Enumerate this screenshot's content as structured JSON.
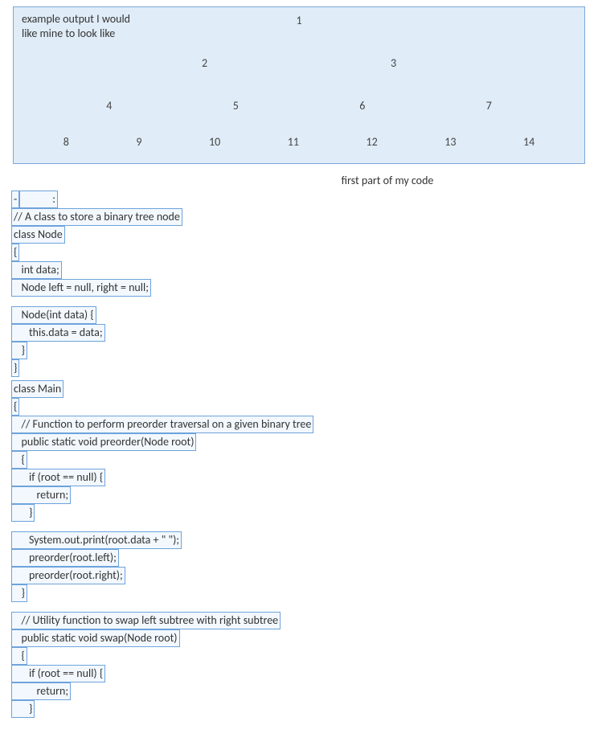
{
  "tree": {
    "caption": "example output I would like mine to look like",
    "rows": [
      [
        "1"
      ],
      [
        "2",
        "3"
      ],
      [
        "4",
        "5",
        "6",
        "7"
      ],
      [
        "8",
        "9",
        "10",
        "11",
        "12",
        "13",
        "14"
      ]
    ]
  },
  "section_label": "first part of my code",
  "code": {
    "l01a": "-",
    "l01b": "            :",
    "l02": "// A class to store a binary tree node",
    "l03": "class Node",
    "l04": "{",
    "l05a": "   int data;",
    "l06a": "   Node left = null, right = null;",
    "l07a": "   Node(int data) {",
    "l08a": "      this.data = data;",
    "l09a": "   }",
    "l10": "}",
    "l11": "class Main",
    "l12": "{",
    "l13a": "   // Function to perform preorder traversal on a given binary tree",
    "l14a": "   public static void preorder(Node root)",
    "l15a": "   {",
    "l16a": "      if (root == null) {",
    "l17a": "         return;",
    "l18a": "      }",
    "l19a": "      System.out.print(root.data + \" \");",
    "l20a": "      preorder(root.left);",
    "l21a": "      preorder(root.right);",
    "l22a": "   }",
    "l23a": "   // Utility function to swap left subtree with right subtree",
    "l24a": "   public static void swap(Node root)",
    "l25a": "   {",
    "l26a": "      if (root == null) {",
    "l27a": "         return;",
    "l28a": "      }"
  }
}
